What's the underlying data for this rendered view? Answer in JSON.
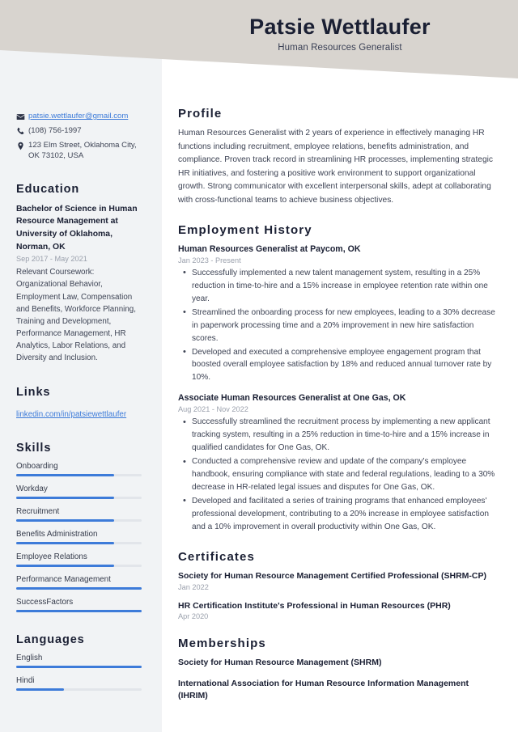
{
  "header": {
    "name": "Patsie Wettlaufer",
    "job_title": "Human Resources Generalist",
    "band_color": "#d8d4cf"
  },
  "theme": {
    "accent": "#3d7bd9",
    "sidebar_bg": "#f1f3f5",
    "heading_color": "#1a1f33",
    "muted_text": "#9aa0ac"
  },
  "sidebar": {
    "contact": {
      "email": {
        "icon": "envelope-icon",
        "value": "patsie.wettlaufer@gmail.com"
      },
      "phone": {
        "icon": "phone-icon",
        "value": "(108) 756-1997"
      },
      "address": {
        "icon": "location-pin-icon",
        "value": "123 Elm Street, Oklahoma City, OK 73102, USA"
      }
    },
    "education": {
      "heading": "Education",
      "degree": "Bachelor of Science in Human Resource Management at University of Oklahoma, Norman, OK",
      "date": "Sep 2017 - May 2021",
      "description": "Relevant Coursework: Organizational Behavior, Employment Law, Compensation and Benefits, Workforce Planning, Training and Development, Performance Management, HR Analytics, Labor Relations, and Diversity and Inclusion."
    },
    "links": {
      "heading": "Links",
      "items": [
        {
          "label": "linkedin.com/in/patsiewettlaufer"
        }
      ]
    },
    "skills": {
      "heading": "Skills",
      "items": [
        {
          "label": "Onboarding",
          "level": 78
        },
        {
          "label": "Workday",
          "level": 78
        },
        {
          "label": "Recruitment",
          "level": 78
        },
        {
          "label": "Benefits Administration",
          "level": 78
        },
        {
          "label": "Employee Relations",
          "level": 78
        },
        {
          "label": "Performance Management",
          "level": 100
        },
        {
          "label": "SuccessFactors",
          "level": 100
        }
      ]
    },
    "languages": {
      "heading": "Languages",
      "items": [
        {
          "label": "English",
          "level": 100
        },
        {
          "label": "Hindi",
          "level": 38
        }
      ]
    }
  },
  "main": {
    "profile": {
      "heading": "Profile",
      "text": "Human Resources Generalist with 2 years of experience in effectively managing HR functions including recruitment, employee relations, benefits administration, and compliance. Proven track record in streamlining HR processes, implementing strategic HR initiatives, and fostering a positive work environment to support organizational growth. Strong communicator with excellent interpersonal skills, adept at collaborating with cross-functional teams to achieve business objectives."
    },
    "employment": {
      "heading": "Employment History",
      "jobs": [
        {
          "title": "Human Resources Generalist at Paycom, OK",
          "date": "Jan 2023 - Present",
          "bullets": [
            "Successfully implemented a new talent management system, resulting in a 25% reduction in time-to-hire and a 15% increase in employee retention rate within one year.",
            "Streamlined the onboarding process for new employees, leading to a 30% decrease in paperwork processing time and a 20% improvement in new hire satisfaction scores.",
            "Developed and executed a comprehensive employee engagement program that boosted overall employee satisfaction by 18% and reduced annual turnover rate by 10%."
          ]
        },
        {
          "title": "Associate Human Resources Generalist at One Gas, OK",
          "date": "Aug 2021 - Nov 2022",
          "bullets": [
            "Successfully streamlined the recruitment process by implementing a new applicant tracking system, resulting in a 25% reduction in time-to-hire and a 15% increase in qualified candidates for One Gas, OK.",
            "Conducted a comprehensive review and update of the company's employee handbook, ensuring compliance with state and federal regulations, leading to a 30% decrease in HR-related legal issues and disputes for One Gas, OK.",
            "Developed and facilitated a series of training programs that enhanced employees' professional development, contributing to a 20% increase in employee satisfaction and a 10% improvement in overall productivity within One Gas, OK."
          ]
        }
      ]
    },
    "certificates": {
      "heading": "Certificates",
      "items": [
        {
          "name": "Society for Human Resource Management Certified Professional (SHRM-CP)",
          "date": "Jan 2022"
        },
        {
          "name": "HR Certification Institute's Professional in Human Resources (PHR)",
          "date": "Apr 2020"
        }
      ]
    },
    "memberships": {
      "heading": "Memberships",
      "items": [
        {
          "name": "Society for Human Resource Management (SHRM)"
        },
        {
          "name": "International Association for Human Resource Information Management (IHRIM)"
        }
      ]
    }
  }
}
